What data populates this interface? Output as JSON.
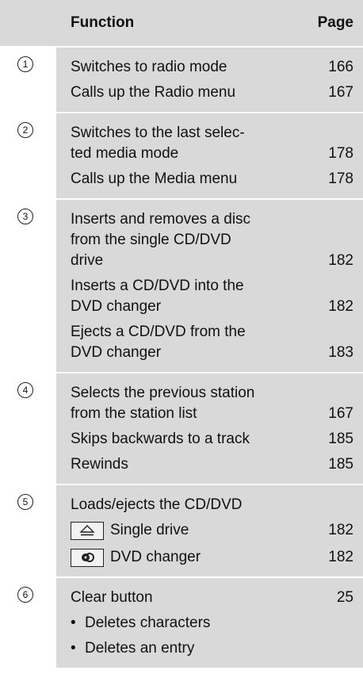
{
  "header": {
    "function": "Function",
    "page": "Page"
  },
  "rows": [
    {
      "num": "1",
      "items": [
        {
          "text": "Switches to radio mode",
          "page": "166"
        },
        {
          "text": "Calls up the Radio menu",
          "page": "167"
        }
      ]
    },
    {
      "num": "2",
      "items": [
        {
          "text": "Switches to the last selec-\nted media mode",
          "page": "178"
        },
        {
          "text": "Calls up the Media menu",
          "page": "178"
        }
      ]
    },
    {
      "num": "3",
      "items": [
        {
          "text": "Inserts and removes a disc\nfrom the single CD/DVD\ndrive",
          "page": "182"
        },
        {
          "text": "Inserts a CD/DVD into the\nDVD changer",
          "page": "182"
        },
        {
          "text": "Ejects a CD/DVD from the\nDVD changer",
          "page": "183"
        }
      ]
    },
    {
      "num": "4",
      "items": [
        {
          "text": "Selects the previous station\nfrom the station list",
          "page": "167"
        },
        {
          "text": "Skips backwards to a track",
          "page": "185"
        },
        {
          "text": "Rewinds",
          "page": "185"
        }
      ]
    },
    {
      "num": "5",
      "title": "Loads/ejects the CD/DVD",
      "keys": [
        {
          "icon": "eject-icon",
          "label": "Single drive",
          "page": "182"
        },
        {
          "icon": "disc-changer-icon",
          "label": "DVD changer",
          "page": "182"
        }
      ]
    },
    {
      "num": "6",
      "title": "Clear button",
      "title_page": "25",
      "bullets": [
        "Deletes characters",
        "Deletes an entry"
      ]
    }
  ]
}
